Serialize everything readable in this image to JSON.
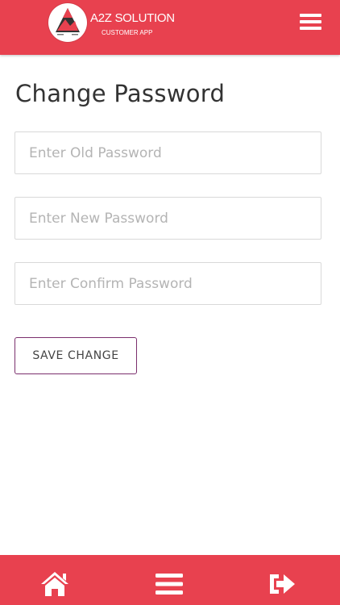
{
  "header": {
    "brand_title": "A2Z SOLUTION",
    "brand_subtitle": "CUSTOMER APP",
    "logo_icon": "a2z-logo-icon",
    "menu_icon": "hamburger-menu-icon"
  },
  "main": {
    "title": "Change Password",
    "fields": [
      {
        "placeholder": "Enter Old Password",
        "value": ""
      },
      {
        "placeholder": "Enter New Password",
        "value": ""
      },
      {
        "placeholder": "Enter Confirm Password",
        "value": ""
      }
    ],
    "save_label": "SAVE CHANGE"
  },
  "bottom_nav": {
    "items": [
      {
        "icon": "home-icon"
      },
      {
        "icon": "menu-icon"
      },
      {
        "icon": "logout-icon"
      }
    ]
  },
  "colors": {
    "brand_red": "#e8414f",
    "button_border": "#7b2f6d",
    "title_text": "#333333"
  }
}
